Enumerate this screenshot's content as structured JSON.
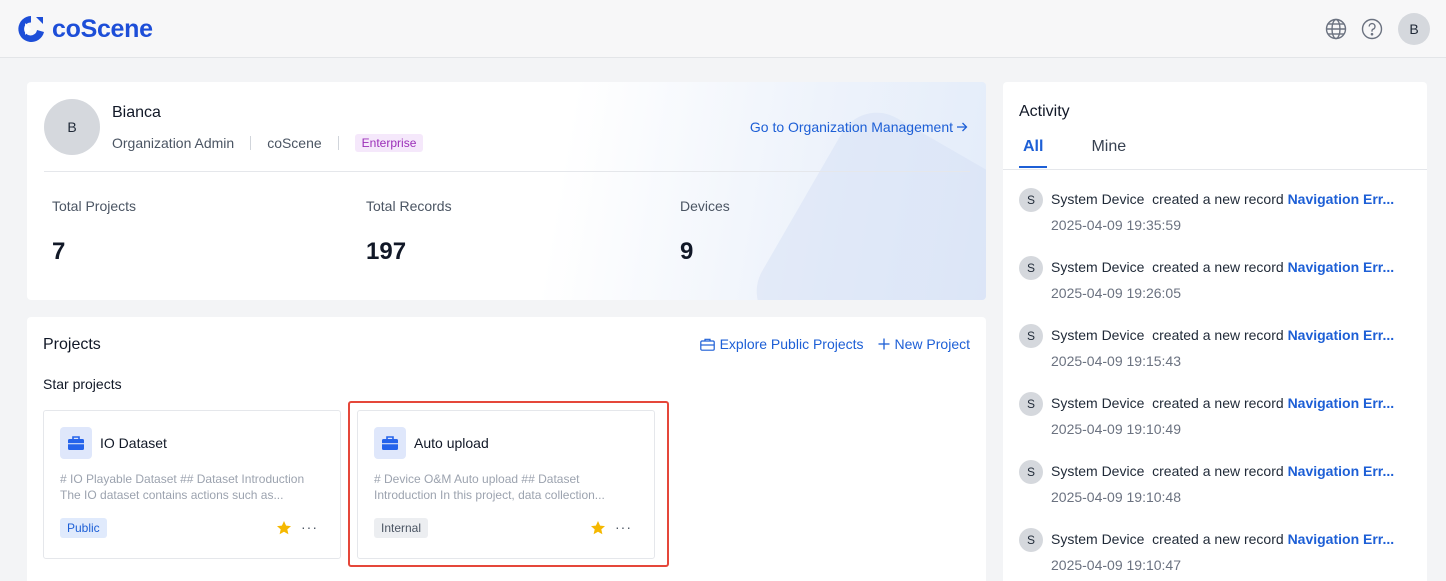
{
  "brand": {
    "name": "coScene"
  },
  "header": {
    "avatar_initial": "B"
  },
  "profile": {
    "avatar_initial": "B",
    "name": "Bianca",
    "role": "Organization Admin",
    "org": "coScene",
    "plan_badge": "Enterprise",
    "manage_link": "Go to Organization Management"
  },
  "stats": [
    {
      "label": "Total Projects",
      "value": "7"
    },
    {
      "label": "Total Records",
      "value": "197"
    },
    {
      "label": "Devices",
      "value": "9"
    }
  ],
  "projects": {
    "title": "Projects",
    "explore_label": "Explore Public Projects",
    "new_label": "New Project",
    "star_title": "Star projects",
    "items": [
      {
        "name": "IO Dataset",
        "desc1": "# IO Playable Dataset ## Dataset Introduction",
        "desc2": "The IO dataset contains actions such as...",
        "visibility": "Public",
        "starred": true
      },
      {
        "name": "Auto upload",
        "desc1": "# Device O&M Auto upload ## Dataset",
        "desc2": "Introduction In this project, data collection...",
        "visibility": "Internal",
        "starred": true
      }
    ]
  },
  "activity": {
    "title": "Activity",
    "tabs": [
      "All",
      "Mine"
    ],
    "active_tab": "All",
    "items": [
      {
        "avatar": "S",
        "actor": "System Device",
        "action": "created a new record",
        "target": "Navigation Err...",
        "time": "2025-04-09 19:35:59"
      },
      {
        "avatar": "S",
        "actor": "System Device",
        "action": "created a new record",
        "target": "Navigation Err...",
        "time": "2025-04-09 19:26:05"
      },
      {
        "avatar": "S",
        "actor": "System Device",
        "action": "created a new record",
        "target": "Navigation Err...",
        "time": "2025-04-09 19:15:43"
      },
      {
        "avatar": "S",
        "actor": "System Device",
        "action": "created a new record",
        "target": "Navigation Err...",
        "time": "2025-04-09 19:10:49"
      },
      {
        "avatar": "S",
        "actor": "System Device",
        "action": "created a new record",
        "target": "Navigation Err...",
        "time": "2025-04-09 19:10:48"
      },
      {
        "avatar": "S",
        "actor": "System Device",
        "action": "created a new record",
        "target": "Navigation Err...",
        "time": "2025-04-09 19:10:47"
      }
    ]
  },
  "colors": {
    "accent": "#1d5fd6",
    "brand": "#1d4ed8",
    "highlight": "#e5473a",
    "star": "#f5b800"
  }
}
